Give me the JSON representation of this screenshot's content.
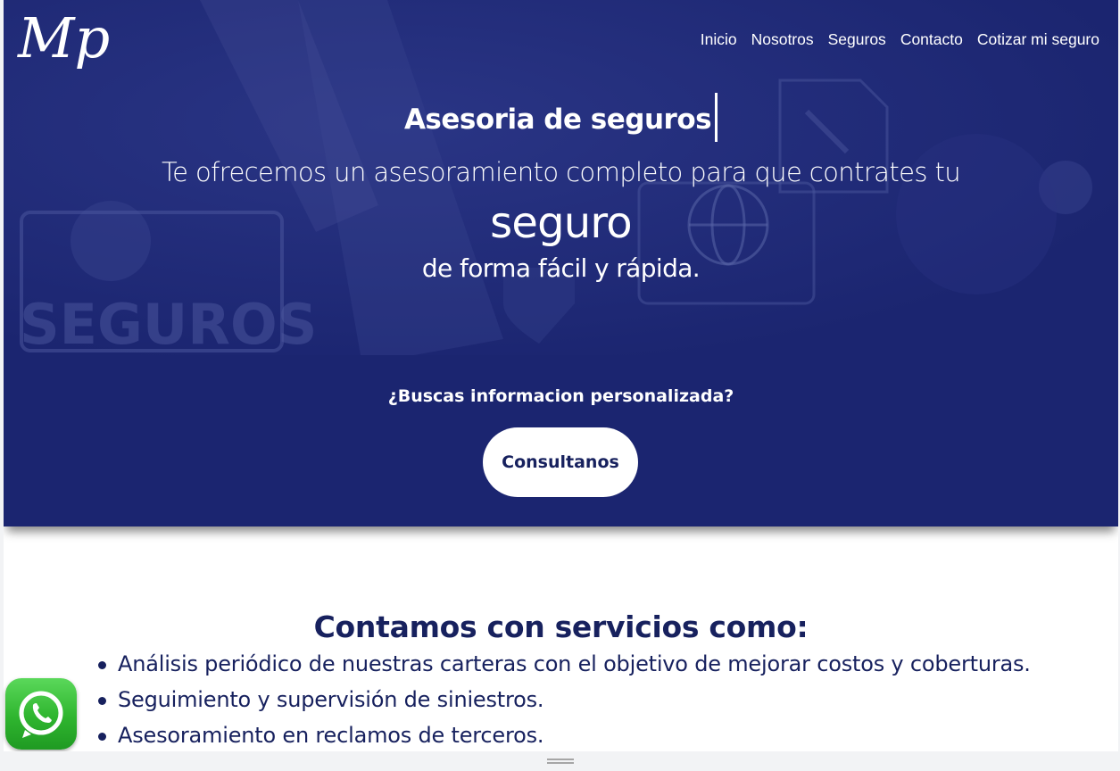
{
  "brand": {
    "logo_text": "Mp"
  },
  "nav": {
    "items": [
      {
        "label": "Inicio"
      },
      {
        "label": "Nosotros"
      },
      {
        "label": "Seguros"
      },
      {
        "label": "Contacto"
      },
      {
        "label": "Cotizar mi seguro"
      }
    ]
  },
  "hero": {
    "title": "Asesoria de seguros",
    "line1": "Te ofrecemos un asesoramiento completo para que contrates tu",
    "line2": "seguro",
    "line3": "de forma fácil y rápida.",
    "background_text": "SEGUROS"
  },
  "cta_band": {
    "question": "¿Buscas informacion personalizada?",
    "button_label": "Consultanos"
  },
  "services": {
    "title": "Contamos con servicios como:",
    "items": [
      "Análisis periódico de nuestras carteras con el objetivo de mejorar costos y coberturas.",
      "Seguimiento y supervisión de siniestros.",
      "Asesoramiento en reclamos de terceros."
    ]
  },
  "colors": {
    "primary": "#1b2570",
    "text_dark": "#17215e",
    "whatsapp": "#2fb52f"
  },
  "icons": {
    "whatsapp": "whatsapp-icon"
  }
}
